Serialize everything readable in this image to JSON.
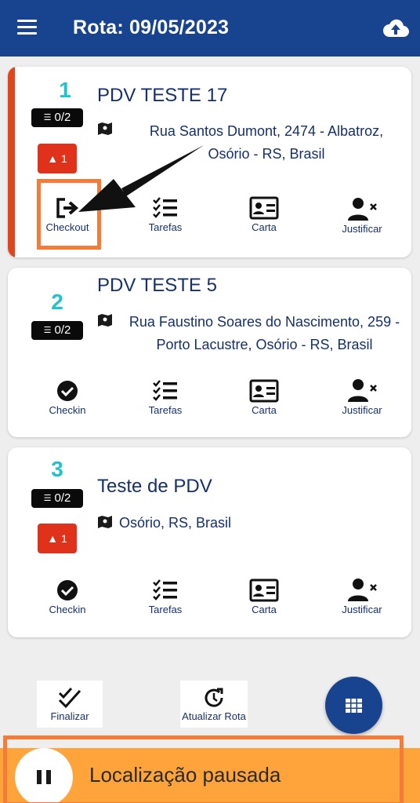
{
  "header": {
    "title": "Rota: 09/05/2023",
    "menu_icon": "hamburger-menu-icon",
    "upload_icon": "cloud-upload-icon"
  },
  "stops": [
    {
      "number": "1",
      "tasks": "0/2",
      "alerts": "1",
      "name": "PDV TESTE 17",
      "address_line1": "Rua Santos Dumont, 2474 - Albatroz,",
      "address_line2": "Osório - RS, Brasil",
      "actions": [
        "Checkout",
        "Tarefas",
        "Carta",
        "Justificar"
      ]
    },
    {
      "number": "2",
      "tasks": "0/2",
      "name": "PDV TESTE 5",
      "address_line1": "Rua Faustino Soares do Nascimento, 259 -",
      "address_line2": "Porto Lacustre, Osório - RS, Brasil",
      "actions": [
        "Checkin",
        "Tarefas",
        "Carta",
        "Justificar"
      ]
    },
    {
      "number": "3",
      "tasks": "0/2",
      "alerts": "1",
      "name": "Teste de PDV",
      "address_line1": "Osório, RS, Brasil",
      "actions": [
        "Checkin",
        "Tarefas",
        "Carta",
        "Justificar"
      ]
    }
  ],
  "bottom": {
    "finalizar": "Finalizar",
    "atualizar": "Atualizar Rota"
  },
  "location": {
    "status": "Localização pausada"
  },
  "colors": {
    "primary": "#17438f",
    "accent": "#22c1cf",
    "alert": "#e0321a",
    "highlight": "#f47b38",
    "pause_bg": "#ffa43a"
  }
}
